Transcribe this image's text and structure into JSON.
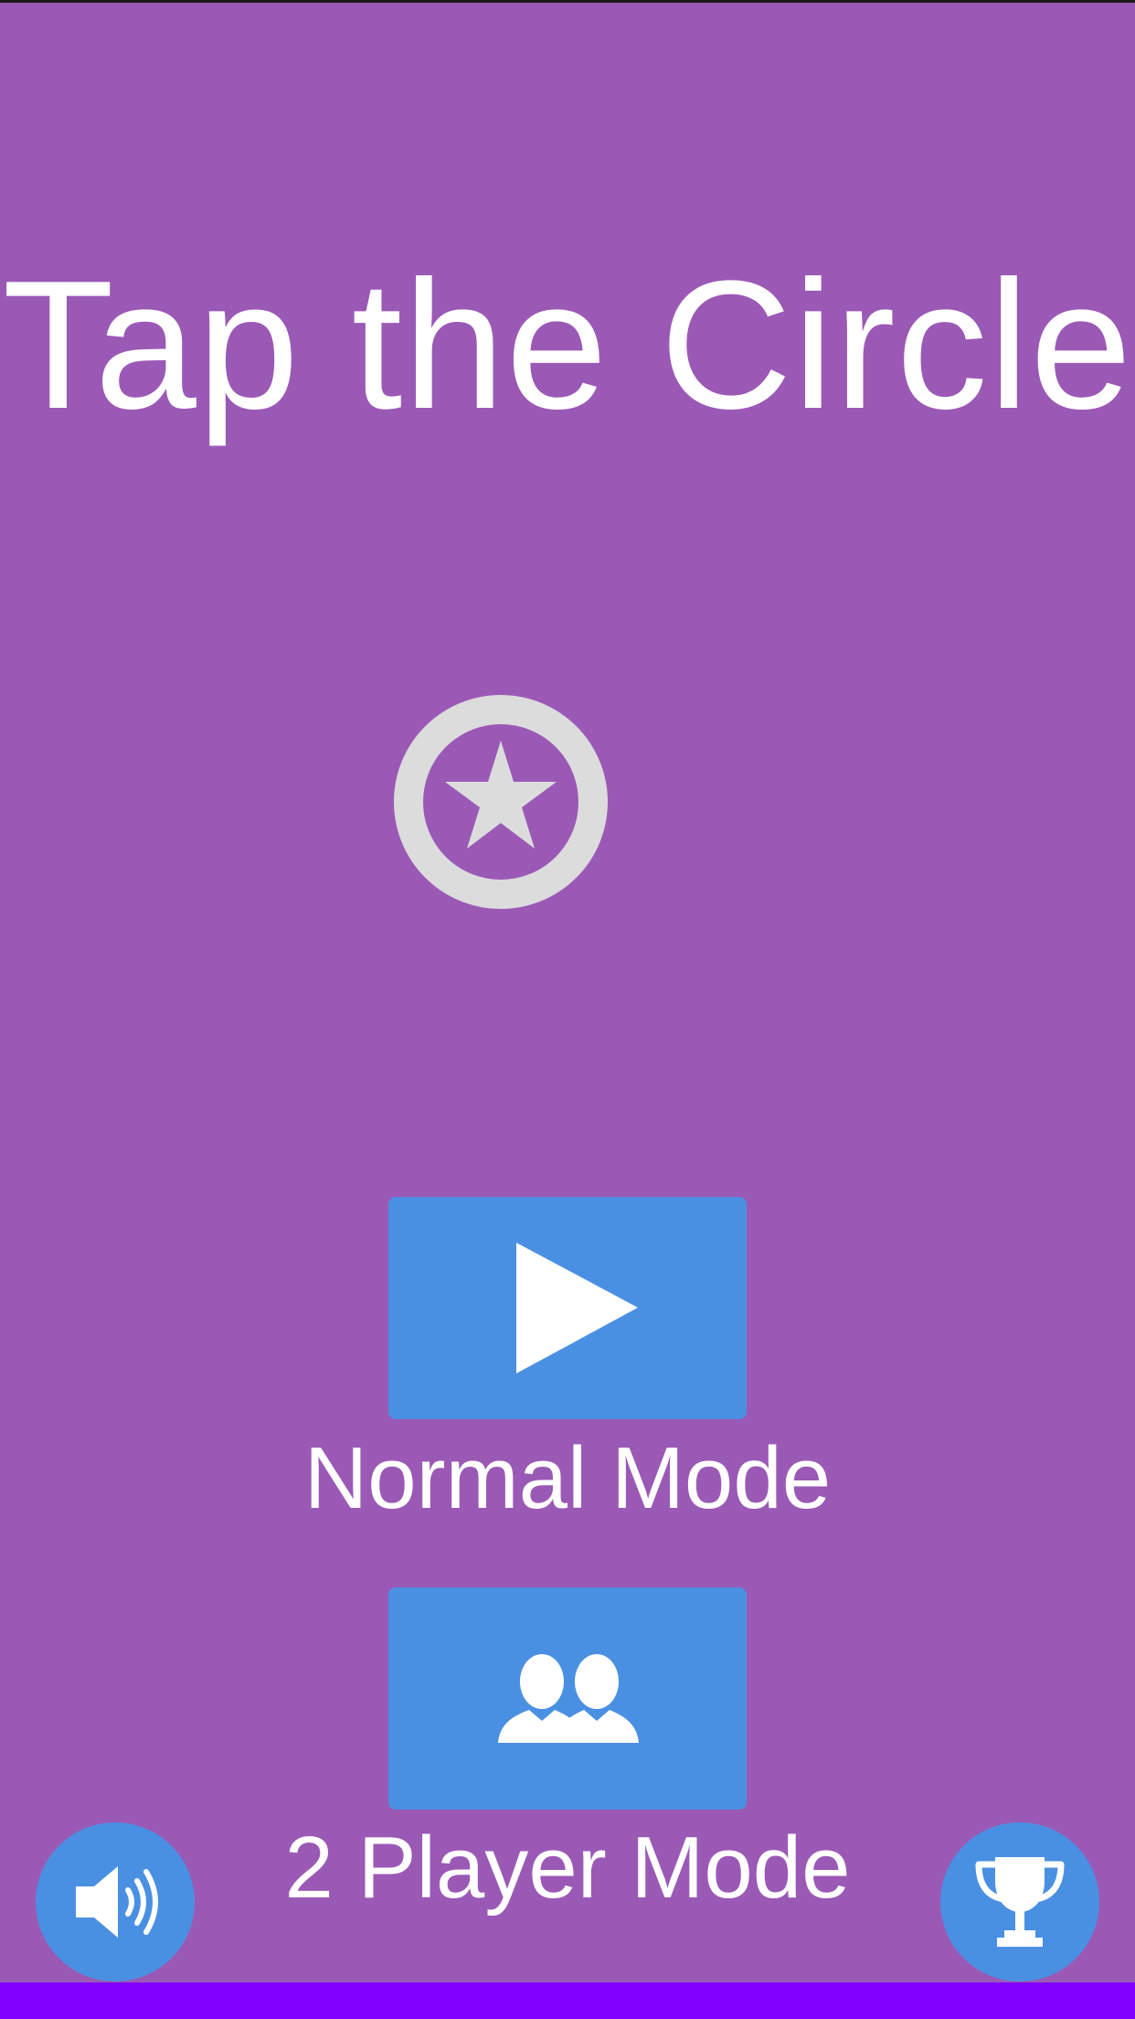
{
  "title": "Tap the Circle",
  "logo": {
    "icon": "star-circle-icon"
  },
  "normal_mode": {
    "icon": "play-icon",
    "label": "Normal Mode"
  },
  "two_player_mode": {
    "icon": "two-users-icon",
    "label": "2 Player Mode"
  },
  "sound_button": {
    "icon": "speaker-icon"
  },
  "leaderboard_button": {
    "icon": "trophy-icon"
  },
  "colors": {
    "background": "#9b59b6",
    "button": "#4a90e2",
    "logo": "#dcdcdc",
    "bottom_bar": "#7f00ff",
    "text": "#ffffff"
  }
}
